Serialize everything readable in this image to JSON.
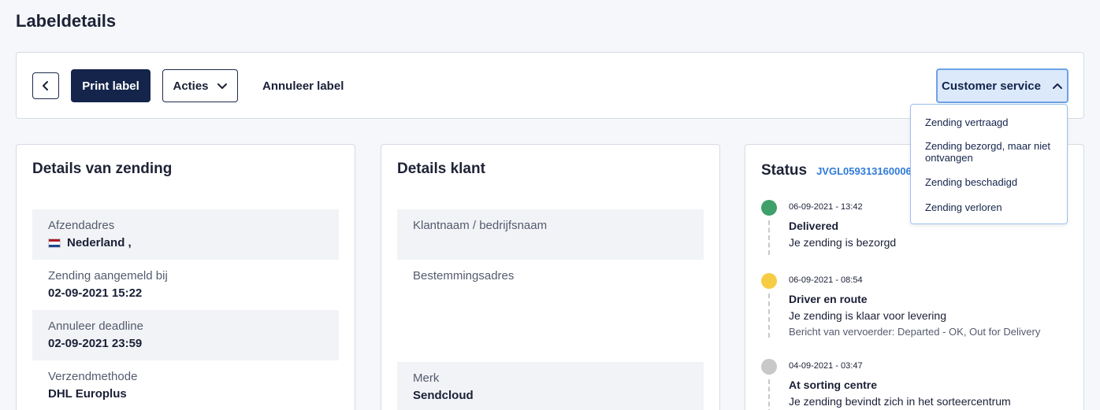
{
  "page": {
    "title": "Labeldetails"
  },
  "toolbar": {
    "print_label": "Print label",
    "acties_label": "Acties",
    "annuleer_label": "Annuleer label",
    "customer_service_label": "Customer service"
  },
  "customer_service_menu": {
    "items": [
      "Zending vertraagd",
      "Zending bezorgd, maar niet ontvangen",
      "Zending beschadigd",
      "Zending verloren"
    ]
  },
  "shipment_details": {
    "title": "Details van zending",
    "fields": [
      {
        "label": "Afzendadres",
        "value": "Nederland ,"
      },
      {
        "label": "Zending aangemeld bij",
        "value": "02-09-2021 15:22"
      },
      {
        "label": "Annuleer deadline",
        "value": "02-09-2021 23:59"
      },
      {
        "label": "Verzendmethode",
        "value": "DHL Europlus"
      }
    ]
  },
  "customer_details": {
    "title": "Details klant",
    "fields": [
      {
        "label": "Klantnaam / bedrijfsnaam",
        "value": ""
      },
      {
        "label": "Bestemmingsadres",
        "value": ""
      },
      {
        "label": "Merk",
        "value": "Sendcloud"
      }
    ]
  },
  "status": {
    "title": "Status",
    "tracking_number": "JVGL059313160006",
    "colors": {
      "delivered": "#3fa06a",
      "en_route": "#f6cd42",
      "sorting": "#c8c8c8"
    },
    "events": [
      {
        "time": "06-09-2021 - 13:42",
        "title": "Delivered",
        "desc": "Je zending is bezorgd",
        "note": ""
      },
      {
        "time": "06-09-2021 - 08:54",
        "title": "Driver en route",
        "desc": "Je zending is klaar voor levering",
        "note": "Bericht van vervoerder: Departed - OK, Out for Delivery"
      },
      {
        "time": "04-09-2021 - 03:47",
        "title": "At sorting centre",
        "desc": "Je zending bevindt zich in het sorteercentrum",
        "note": ""
      }
    ]
  }
}
